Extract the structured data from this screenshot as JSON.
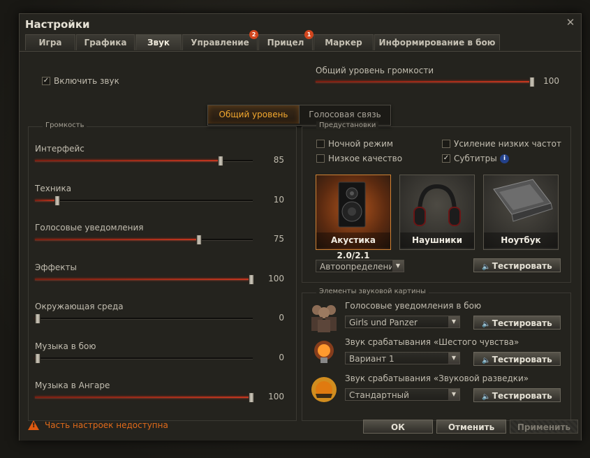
{
  "window": {
    "title": "Настройки",
    "close_glyph": "✕"
  },
  "tabs": [
    {
      "label": "Игра",
      "active": false,
      "badge": ""
    },
    {
      "label": "Графика",
      "active": false,
      "badge": ""
    },
    {
      "label": "Звук",
      "active": true,
      "badge": ""
    },
    {
      "label": "Управление",
      "active": false,
      "badge": "2"
    },
    {
      "label": "Прицел",
      "active": false,
      "badge": "1"
    },
    {
      "label": "Маркер",
      "active": false,
      "badge": ""
    },
    {
      "label": "Информирование в бою",
      "active": false,
      "badge": ""
    }
  ],
  "enable_sound": {
    "label": "Включить звук",
    "checked": true
  },
  "master_volume": {
    "label": "Общий уровень громкости",
    "value": 100
  },
  "subtabs": [
    {
      "label": "Общий уровень",
      "active": true
    },
    {
      "label": "Голосовая связь",
      "active": false
    }
  ],
  "volume": {
    "title": "Громкость",
    "items": [
      {
        "label": "Интерфейс",
        "value": 85
      },
      {
        "label": "Техника",
        "value": 10
      },
      {
        "label": "Голосовые уведомления",
        "value": 75
      },
      {
        "label": "Эффекты",
        "value": 100
      },
      {
        "label": "Окружающая среда",
        "value": 0
      },
      {
        "label": "Музыка в бою",
        "value": 0
      },
      {
        "label": "Музыка в Ангаре",
        "value": 100
      }
    ]
  },
  "presets": {
    "title": "Предустановки",
    "options": [
      {
        "label": "Ночной режим",
        "checked": false
      },
      {
        "label": "Усиление низких частот",
        "checked": false
      },
      {
        "label": "Низкое качество",
        "checked": false
      },
      {
        "label": "Субтитры",
        "checked": true
      }
    ],
    "info_glyph": "i",
    "devices": [
      {
        "label": "Акустика 2.0/2.1",
        "active": true
      },
      {
        "label": "Наушники",
        "active": false
      },
      {
        "label": "Ноутбук",
        "active": false
      }
    ],
    "autodetect": "Автоопределение",
    "test_label": "Тестировать"
  },
  "elements": {
    "title": "Элементы звуковой картины",
    "items": [
      {
        "title": "Голосовые уведомления в бою",
        "value": "Girls und Panzer",
        "icon": "crew-icon",
        "test_label": "Тестировать"
      },
      {
        "title": "Звук срабатывания «Шестого чувства»",
        "value": "Вариант 1",
        "icon": "sixth-sense-bulb-icon",
        "test_label": "Тестировать"
      },
      {
        "title": "Звук срабатывания «Звуковой разведки»",
        "value": "Стандартный",
        "icon": "sound-recon-icon",
        "test_label": "Тестировать"
      }
    ]
  },
  "footer": {
    "warning": "Часть настроек недоступна",
    "ok": "ОК",
    "cancel": "Отменить",
    "apply": "Применить"
  },
  "colors": {
    "accent": "#f3a82e",
    "slider_fill": "#c3361f",
    "warning": "#e06a1a",
    "badge": "#d2461e"
  }
}
